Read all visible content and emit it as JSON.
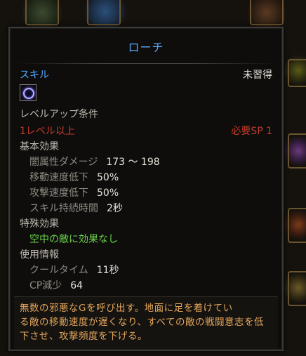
{
  "tooltip": {
    "title": "ローチ",
    "skill_label": "スキル",
    "learn_status": "未習得",
    "levelup_header": "レベルアップ条件",
    "level_req": "1レベル以上",
    "sp_req": "必要SP 1",
    "basic_effect_header": "基本効果",
    "basic_effects": [
      {
        "label": "闇属性ダメージ",
        "value": "173 ～ 198"
      },
      {
        "label": "移動速度低下",
        "value": "50%"
      },
      {
        "label": "攻撃速度低下",
        "value": "50%"
      },
      {
        "label": "スキル持続時間",
        "value": "2秒"
      }
    ],
    "special_effect_header": "特殊効果",
    "special_effect": "空中の敵に効果なし",
    "usage_header": "使用情報",
    "usage": [
      {
        "label": "クールタイム",
        "value": "11秒"
      },
      {
        "label": "CP減少",
        "value": "64"
      }
    ],
    "description_lines": [
      "無数の邪悪なGを呼び出す。地面に足を着けてい",
      "る敵の移動速度が遅くなり、すべての敵の戦闘意志を低",
      "下させ、攻撃頻度を下げる。"
    ]
  },
  "colors": {
    "title": "#5aa8ff",
    "requirement": "#c23a2c",
    "special": "#6ad24a",
    "description": "#e2a45a"
  }
}
